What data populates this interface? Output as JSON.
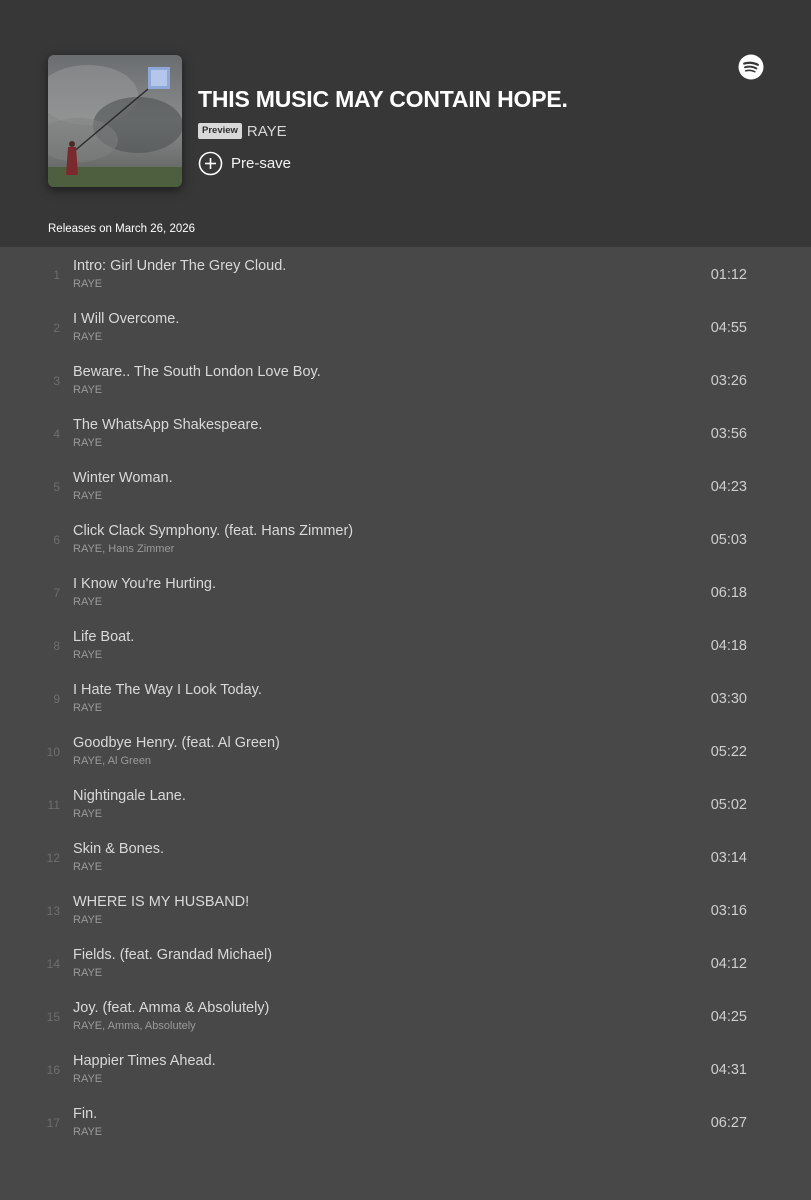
{
  "album": {
    "title": "THIS MUSIC MAY CONTAIN HOPE.",
    "badge": "Preview",
    "artist": "RAYE",
    "presave_label": "Pre-save",
    "release_date": "Releases on March 26, 2026"
  },
  "icons": {
    "brand": "spotify-logo-icon",
    "presave": "plus-circle-icon"
  },
  "colors": {
    "header_bg": "#373737",
    "list_bg": "#484848",
    "title": "#ffffff",
    "badge_bg": "#d8d8d8"
  },
  "tracks": [
    {
      "number": "1",
      "title": "Intro: Girl Under The Grey Cloud.",
      "artists": "RAYE",
      "duration": "01:12"
    },
    {
      "number": "2",
      "title": "I Will Overcome.",
      "artists": "RAYE",
      "duration": "04:55"
    },
    {
      "number": "3",
      "title": "Beware.. The South London Love Boy.",
      "artists": "RAYE",
      "duration": "03:26"
    },
    {
      "number": "4",
      "title": "The WhatsApp Shakespeare.",
      "artists": "RAYE",
      "duration": "03:56"
    },
    {
      "number": "5",
      "title": "Winter Woman.",
      "artists": "RAYE",
      "duration": "04:23"
    },
    {
      "number": "6",
      "title": "Click Clack Symphony. (feat. Hans Zimmer)",
      "artists": "RAYE, Hans Zimmer",
      "duration": "05:03"
    },
    {
      "number": "7",
      "title": "I Know You're Hurting.",
      "artists": "RAYE",
      "duration": "06:18"
    },
    {
      "number": "8",
      "title": "Life Boat.",
      "artists": "RAYE",
      "duration": "04:18"
    },
    {
      "number": "9",
      "title": "I Hate The Way I Look Today.",
      "artists": "RAYE",
      "duration": "03:30"
    },
    {
      "number": "10",
      "title": "Goodbye Henry. (feat. Al Green)",
      "artists": "RAYE, Al Green",
      "duration": "05:22"
    },
    {
      "number": "11",
      "title": "Nightingale Lane.",
      "artists": "RAYE",
      "duration": "05:02"
    },
    {
      "number": "12",
      "title": "Skin & Bones.",
      "artists": "RAYE",
      "duration": "03:14"
    },
    {
      "number": "13",
      "title": "WHERE IS MY HUSBAND!",
      "artists": "RAYE",
      "duration": "03:16"
    },
    {
      "number": "14",
      "title": "Fields. (feat. Grandad Michael)",
      "artists": "RAYE",
      "duration": "04:12"
    },
    {
      "number": "15",
      "title": "Joy. (feat. Amma & Absolutely)",
      "artists": "RAYE, Amma, Absolutely",
      "duration": "04:25"
    },
    {
      "number": "16",
      "title": "Happier Times Ahead.",
      "artists": "RAYE",
      "duration": "04:31"
    },
    {
      "number": "17",
      "title": "Fin.",
      "artists": "RAYE",
      "duration": "06:27"
    }
  ]
}
